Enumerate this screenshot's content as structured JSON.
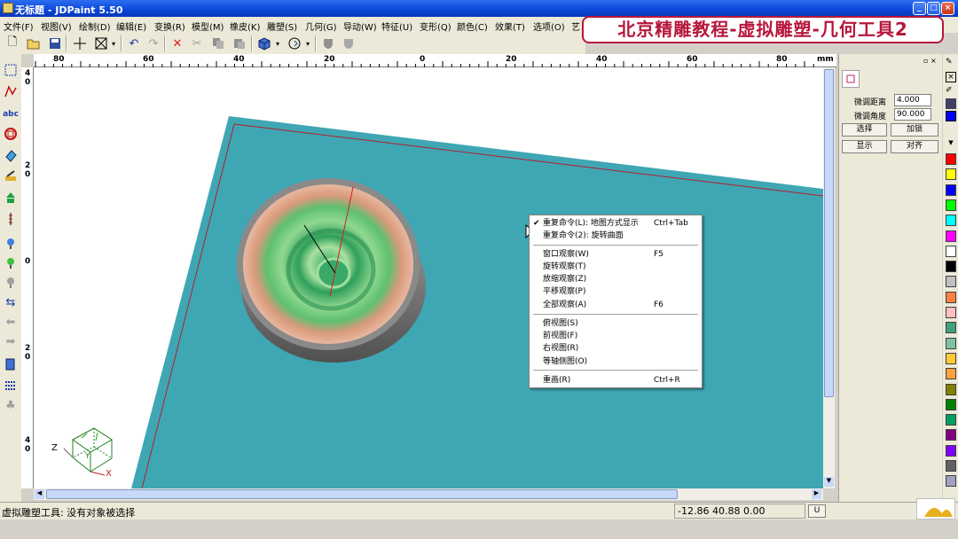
{
  "window": {
    "title": "无标题 - JDPaint 5.50"
  },
  "banner": {
    "text": "北京精雕教程-虚拟雕塑-几何工具2"
  },
  "menu": [
    "文件(F)",
    "视图(V)",
    "绘制(D)",
    "编辑(E)",
    "变换(R)",
    "模型(M)",
    "橡皮(K)",
    "雕塑(S)",
    "几何(G)",
    "导动(W)",
    "特征(U)",
    "变形(Q)",
    "颜色(C)",
    "效果(T)",
    "选项(O)",
    "艺"
  ],
  "ruler_top": [
    "80",
    "60",
    "40",
    "20",
    "0",
    "20",
    "40",
    "60",
    "80",
    "mm"
  ],
  "ruler_left": [
    "4\n0",
    "2\n0",
    "0",
    "2\n0",
    "4\n0"
  ],
  "right_panel": {
    "dist_label": "微调距离",
    "dist_value": "4.000",
    "angle_label": "微调角度",
    "angle_value": "90.000",
    "select_btn": "选择",
    "lock_btn": "加锁",
    "show_btn": "显示",
    "align_btn": "对齐"
  },
  "context_menu": {
    "items": [
      {
        "label": "重复命令(L): 地图方式显示",
        "shortcut": "Ctrl+Tab",
        "checked": true
      },
      {
        "label": "重复命令(2): 旋转曲面",
        "shortcut": ""
      },
      {
        "label": "窗口观察(W)",
        "shortcut": "F5"
      },
      {
        "label": "旋转观察(T)",
        "shortcut": ""
      },
      {
        "label": "放缩观察(Z)",
        "shortcut": ""
      },
      {
        "label": "平移观察(P)",
        "shortcut": ""
      },
      {
        "label": "全部观察(A)",
        "shortcut": "F6"
      },
      {
        "label": "俯视图(S)",
        "shortcut": ""
      },
      {
        "label": "前视图(F)",
        "shortcut": ""
      },
      {
        "label": "右视图(R)",
        "shortcut": ""
      },
      {
        "label": "等轴侧图(O)",
        "shortcut": ""
      },
      {
        "label": "重画(R)",
        "shortcut": "Ctrl+R"
      }
    ]
  },
  "axes": {
    "x": "X",
    "y": "Y",
    "z": "Z"
  },
  "status": {
    "message": "虚拟雕塑工具: 没有对象被选择",
    "coords": "-12.86 40.88 0.00",
    "unit_btn": "U"
  },
  "colors": {
    "plate": "#3fa6b4",
    "palette": [
      "#ff0000",
      "#ffff00",
      "#0000ff",
      "#00ff00",
      "#00ffff",
      "#ff00ff",
      "#ffffff",
      "#000000",
      "#c0c0c0",
      "#ff8040",
      "#ffc0c0",
      "#40a080",
      "#80c0a0",
      "#ffcc33",
      "#ffa040",
      "#808000",
      "#008000",
      "#00a060",
      "#800080",
      "#8000ff",
      "#606060",
      "#a0a0c0"
    ]
  }
}
